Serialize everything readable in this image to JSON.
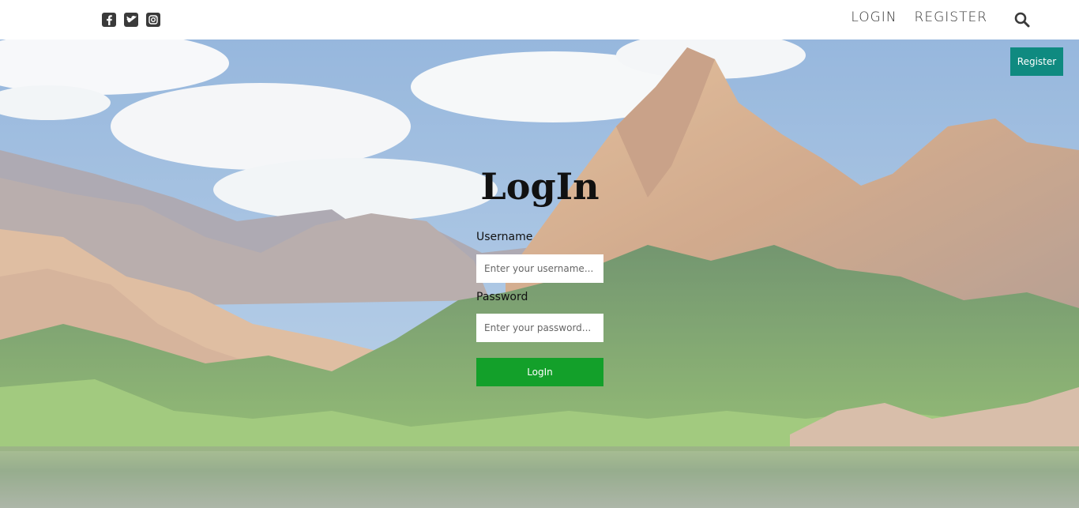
{
  "header": {
    "social": [
      {
        "icon": "facebook-icon"
      },
      {
        "icon": "twitter-icon"
      },
      {
        "icon": "instagram-icon"
      }
    ],
    "nav": {
      "login_label": "LOGIN",
      "register_label": "REGISTER"
    },
    "search_icon": "search-icon"
  },
  "hero": {
    "register_button_label": "Register",
    "form": {
      "title": "LogIn",
      "username_label": "Username",
      "username_placeholder": "Enter your username...",
      "password_label": "Password",
      "password_placeholder": "Enter your password...",
      "submit_label": "LogIn"
    }
  },
  "colors": {
    "register_button": "#0f8a80",
    "login_button": "#13a02a",
    "nav_text": "#333333"
  }
}
